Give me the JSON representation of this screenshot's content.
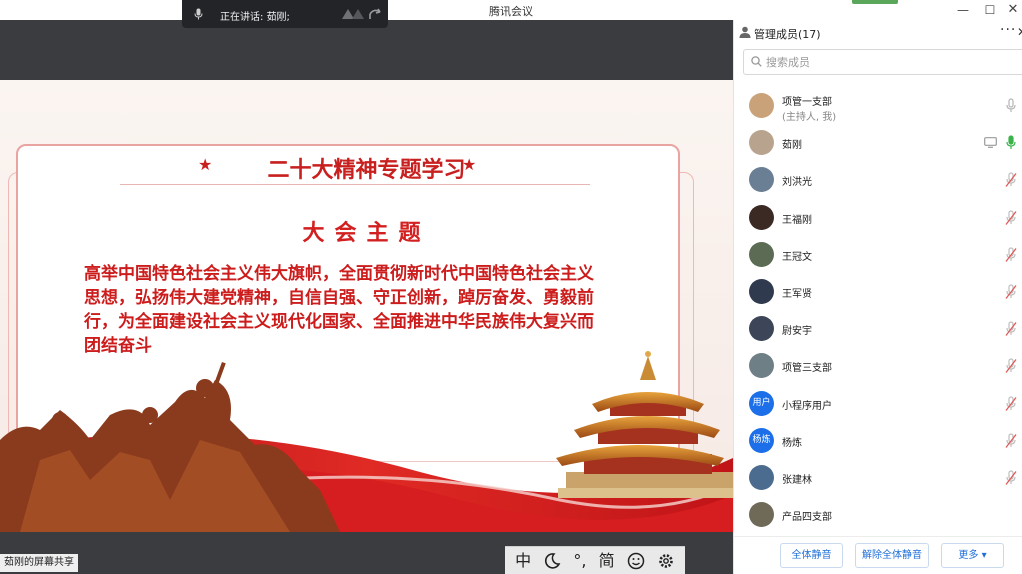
{
  "window": {
    "title": "腾讯会议",
    "speaking_prefix": "正在讲话:",
    "speaking_name": "茹刚;"
  },
  "share": {
    "sharing_label": "茹刚的屏幕共享"
  },
  "slide": {
    "title": "二十大精神专题学习",
    "star": "★",
    "subtitle": "大会主题",
    "body": "高举中国特色社会主义伟大旗帜，全面贯彻新时代中国特色社会主义思想，弘扬伟大建党精神，自信自强、守正创新，踔厉奋发、勇毅前行，为全面建设社会主义现代化国家、全面推进中华民族伟大复兴而团结奋斗"
  },
  "ime": {
    "items": [
      "中",
      "°,",
      "简"
    ]
  },
  "panel": {
    "title": "管理成员(17)",
    "more": "···",
    "search_placeholder": "搜索成员",
    "members": [
      {
        "name": "项管一支部",
        "sub": "(主持人, 我)",
        "avatar_text": "",
        "avatar_color": "#c9a27a",
        "mic": "off-gray"
      },
      {
        "name": "茹刚",
        "sub": "",
        "avatar_text": "",
        "avatar_color": "#b8a48e",
        "mic": "on-green"
      },
      {
        "name": "刘洪光",
        "sub": "",
        "avatar_text": "",
        "avatar_color": "#6a7f93",
        "mic": "muted"
      },
      {
        "name": "王福刚",
        "sub": "",
        "avatar_text": "",
        "avatar_color": "#3b2a24",
        "mic": "muted"
      },
      {
        "name": "王冠文",
        "sub": "",
        "avatar_text": "",
        "avatar_color": "#5b6b54",
        "mic": "muted"
      },
      {
        "name": "王军贤",
        "sub": "",
        "avatar_text": "",
        "avatar_color": "#2f3a4e",
        "mic": "muted"
      },
      {
        "name": "尉安宇",
        "sub": "",
        "avatar_text": "",
        "avatar_color": "#3c4658",
        "mic": "muted"
      },
      {
        "name": "项管三支部",
        "sub": "",
        "avatar_text": "",
        "avatar_color": "#6f7f86",
        "mic": "muted"
      },
      {
        "name": "小程序用户",
        "sub": "",
        "avatar_text": "用户",
        "avatar_color": "#1c6fe8",
        "mic": "muted"
      },
      {
        "name": "杨炼",
        "sub": "",
        "avatar_text": "杨炼",
        "avatar_color": "#1c6fe8",
        "mic": "muted"
      },
      {
        "name": "张建林",
        "sub": "",
        "avatar_text": "",
        "avatar_color": "#4b6c8e",
        "mic": "muted"
      },
      {
        "name": "产品四支部",
        "sub": "",
        "avatar_text": "",
        "avatar_color": "#6f6a58",
        "mic": "none"
      }
    ],
    "mute_all": "全体静音",
    "unmute_all": "解除全体静音",
    "more_btn": "更多 ▾"
  },
  "colors": {
    "accent_blue": "#1f6fd9",
    "mic_green": "#3bb34a",
    "muted_red": "#e05a5a",
    "slide_red": "#cc1c1c"
  }
}
